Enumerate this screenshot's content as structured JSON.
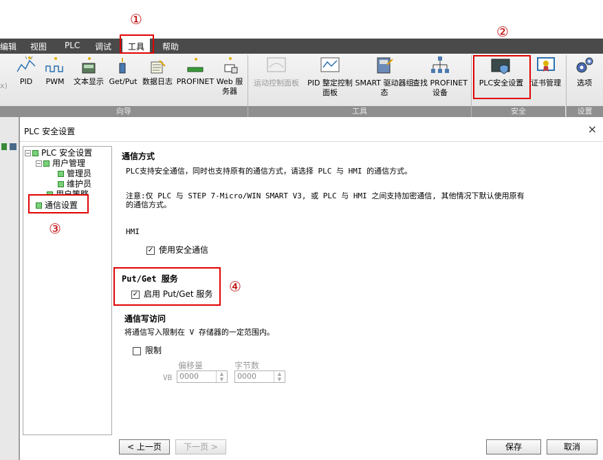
{
  "markers": [
    "①",
    "②",
    "③",
    "④"
  ],
  "menu": {
    "items": [
      "编辑",
      "视图",
      "PLC",
      "调试",
      "工具",
      "帮助"
    ]
  },
  "ribbon": {
    "wizard_cut": "x)",
    "wizards": [
      "PID",
      "PWM",
      "文本显示",
      "Get/Put",
      "数据日志",
      "PROFINET",
      "Web 服务器"
    ],
    "wizard_group": "向导",
    "tools": {
      "motion": "运动控制面板",
      "pid": "PID 整定控制面板",
      "smart": "SMART 驱动器组态",
      "find": "查找 PROFINET 设备"
    },
    "tools_group": "工具",
    "security": {
      "plc_security": "PLC安全设置",
      "cert": "证书管理"
    },
    "security_group": "安全",
    "options": "选项",
    "settings_group": "设置"
  },
  "dialog": {
    "title": "PLC 安全设置",
    "close": "×",
    "tree": {
      "root": "PLC 安全设置",
      "user_mgmt": "用户管理",
      "admin": "管理员",
      "maintainer": "维护员",
      "user_policy": "用户策略",
      "comm": "通信设置"
    },
    "section1_title": "通信方式",
    "section1_desc": "PLC支持安全通信，同时也支持原有的通信方式，请选择 PLC 与 HMI 的通信方式。",
    "note_line1": "注意:仅 PLC 与 STEP 7-Micro/WIN SMART V3, 或 PLC 与 HMI 之间支持加密通信, 其他情况下默认使用原有",
    "note_line2": "的通信方式。",
    "hmi_label": "HMI",
    "secure_comm": "使用安全通信",
    "putget_title": "Put/Get 服务",
    "putget_enable": "启用 Put/Get 服务",
    "write_title": "通信写访问",
    "write_desc": "将通信写入限制在 V 存储器的一定范围内。",
    "limit": "限制",
    "offset_label": "偏移量",
    "bytes_label": "字节数",
    "vb": "VB",
    "offset_value": "0000",
    "bytes_value": "0000",
    "prev": "< 上一页",
    "next": "下一页 >",
    "save": "保存",
    "cancel": "取消"
  },
  "colors": {
    "highlight": "#e00000",
    "menubar": "#4a4a4a"
  }
}
